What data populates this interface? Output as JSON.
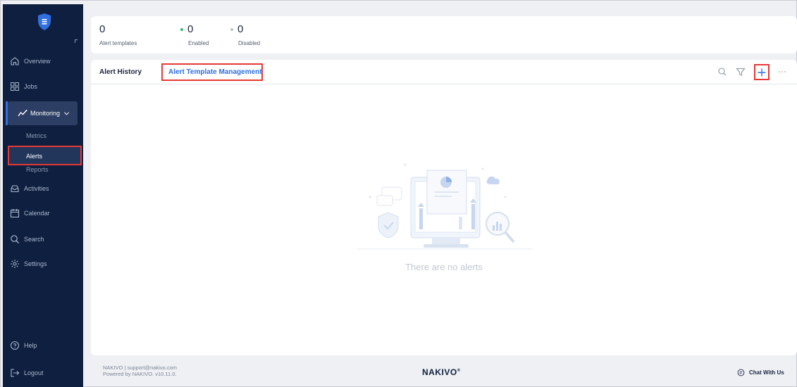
{
  "sidebar": {
    "items": [
      {
        "label": "Overview",
        "icon": "home-icon"
      },
      {
        "label": "Jobs",
        "icon": "grid-icon"
      },
      {
        "label": "Monitoring",
        "icon": "chart-line-icon",
        "expanded": true
      },
      {
        "label": "Activities",
        "icon": "inbox-icon"
      },
      {
        "label": "Calendar",
        "icon": "calendar-icon"
      },
      {
        "label": "Search",
        "icon": "search-icon"
      },
      {
        "label": "Settings",
        "icon": "gear-icon"
      }
    ],
    "monitoring_sub": [
      {
        "label": "Metrics"
      },
      {
        "label": "Alerts",
        "active": true
      },
      {
        "label": "Reports"
      }
    ],
    "help_label": "Help",
    "logout_label": "Logout"
  },
  "stats": {
    "templates": {
      "value": "0",
      "label": "Alert templates"
    },
    "enabled": {
      "value": "0",
      "label": "Enabled",
      "color": "#2ebf6a"
    },
    "disabled": {
      "value": "0",
      "label": "Disabled",
      "color": "#b9bfcb"
    }
  },
  "main": {
    "tabs": [
      {
        "label": "Alert History"
      },
      {
        "label": "Alert Template Management",
        "active": true
      }
    ],
    "empty_message": "There are no alerts"
  },
  "footer": {
    "support_line": "NAKIVO | support@nakivo.com",
    "version_line": "Powered by NAKIVO. v10.11.0.",
    "brand": "NAKIVO",
    "brand_mark": "®",
    "chat_label": "Chat With Us"
  },
  "colors": {
    "sidebar_bg": "#0e1f3f",
    "accent": "#2f6fe0",
    "highlight": "#e53935"
  }
}
